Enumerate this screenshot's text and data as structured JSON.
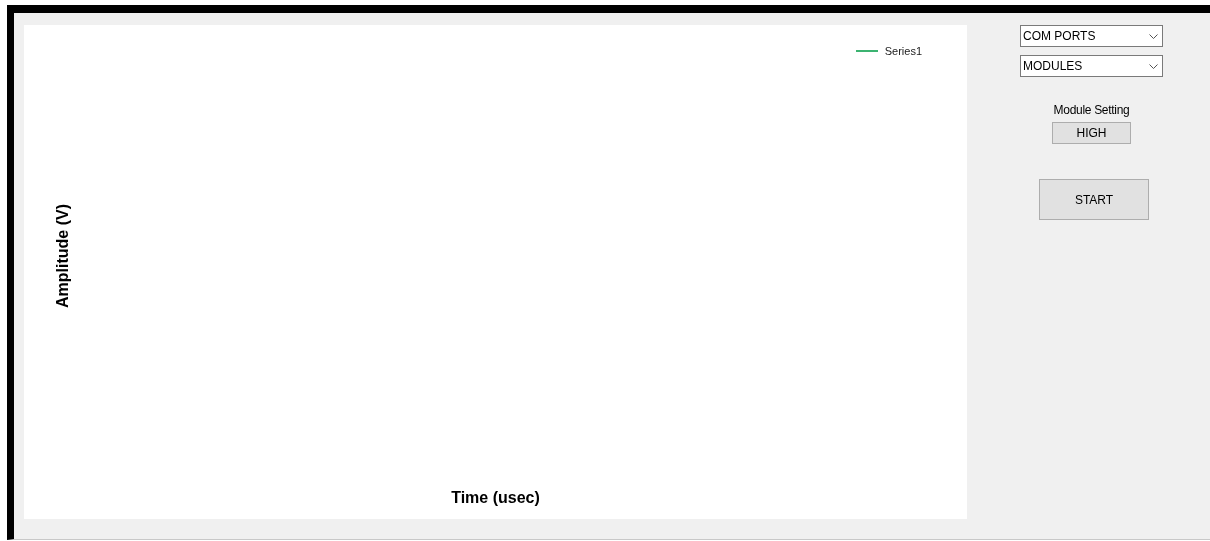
{
  "chart": {
    "legend": [
      {
        "name": "Series1",
        "color": "#3cb371"
      }
    ],
    "y_axis_title": "Amplitude (V)",
    "x_axis_title": "Time (usec)"
  },
  "controls": {
    "dropdowns": [
      {
        "value": "COM PORTS"
      },
      {
        "value": "MODULES"
      }
    ],
    "module_setting": {
      "label": "Module Setting",
      "value": "HIGH"
    },
    "start_button": "START"
  }
}
